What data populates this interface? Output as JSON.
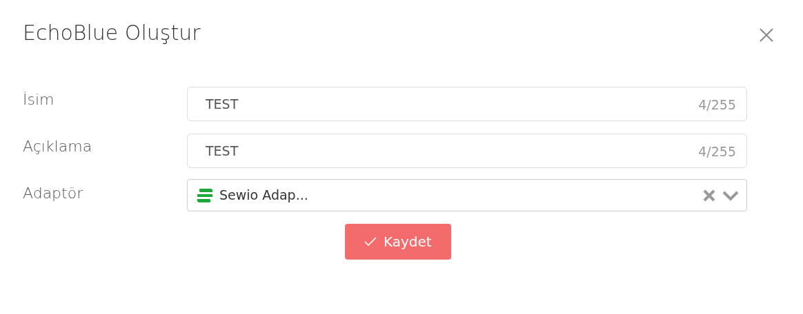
{
  "modal": {
    "title": "EchoBlue Oluştur"
  },
  "fields": [
    {
      "kind": "text",
      "label": "İsim",
      "value": "TEST",
      "counter": "4/255"
    },
    {
      "kind": "text",
      "label": "Açıklama",
      "value": "TEST",
      "counter": "4/255"
    },
    {
      "kind": "select",
      "label": "Adaptör",
      "value": "Sewio Adap..."
    }
  ],
  "submit": {
    "label": "Kaydet"
  }
}
